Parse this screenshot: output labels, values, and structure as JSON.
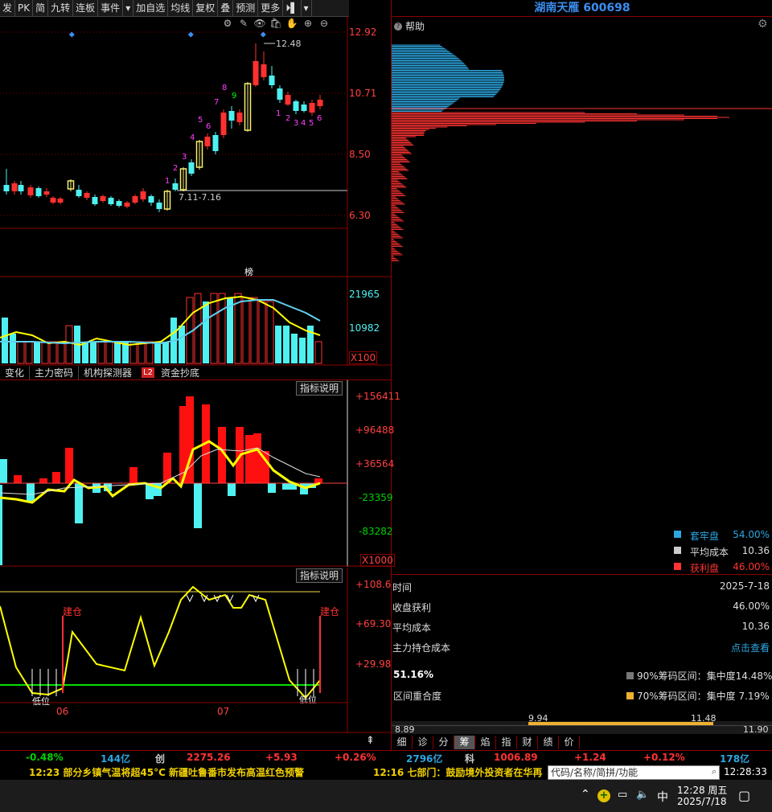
{
  "toolbar": {
    "items": [
      "发",
      "PK",
      "简",
      "九转",
      "连板",
      "事件",
      "▾",
      "加自选",
      "均线",
      "复权",
      "叠",
      "预测",
      "更多",
      "⏵▌",
      "▾"
    ]
  },
  "chart_tools": [
    "⚙",
    "✎",
    "👁",
    "🛍",
    "✋",
    "⊕",
    "⊖"
  ],
  "price_axis": [
    "12.92",
    "10.71",
    "8.50",
    "6.30"
  ],
  "annotations": {
    "high": "12.48",
    "range": "7.11-7.16",
    "bang": "榜",
    "td_up": [
      "1",
      "2",
      "3",
      "4",
      "5",
      "6",
      "7",
      "8",
      "9"
    ],
    "td_down": [
      "1",
      "2",
      "3",
      "4",
      "5",
      "6"
    ]
  },
  "volume": {
    "axis": [
      "21965",
      "10982",
      "X100"
    ]
  },
  "indicator_tabs": [
    "变化",
    "主力密码",
    "机构探测器",
    "L2",
    "资金抄底"
  ],
  "indicator1": {
    "button": "指标说明",
    "axis": [
      "+156411",
      "+96488",
      "+36564",
      "-23359",
      "-83282"
    ],
    "unit": "X1000"
  },
  "indicator2": {
    "button": "指标说明",
    "axis": [
      "+108.6",
      "+69.30",
      "+29.98"
    ],
    "jiancang": "建仓",
    "low_label": "低位",
    "month_labels": [
      "06",
      "07"
    ]
  },
  "right": {
    "title": "湖南天雁 600698",
    "help": "帮助",
    "legend": [
      {
        "label": "套牢盘",
        "value": "54.00%",
        "color": "#2ca6e0"
      },
      {
        "label": "平均成本",
        "value": "10.36",
        "color": "#cccccc"
      },
      {
        "label": "获利盘",
        "value": "46.00%",
        "color": "#ff3333"
      }
    ],
    "info": [
      {
        "label": "时间",
        "value": "2025-7-18"
      },
      {
        "label": "收盘获利",
        "value": "46.00%"
      },
      {
        "label": "平均成本",
        "value": "10.36"
      },
      {
        "label": "主力持仓成本",
        "value": "点击查看"
      }
    ],
    "overlap_pct": "51.16%",
    "overlap_label": "区间重合度",
    "band90": "90%筹码区间：集中度14.48%",
    "band70": "70%筹码区间：集中度 7.19%",
    "band_low": "8.89",
    "band_v1": "9.94",
    "band_v2": "11.48",
    "band_high": "11.90",
    "bottom_tabs": [
      "细",
      "诊",
      "分",
      "筹",
      "焰",
      "指",
      "财",
      "绩",
      "价"
    ]
  },
  "ticker1": [
    {
      "text": "-0.48%",
      "color": "#00d000"
    },
    {
      "text": "144亿",
      "color": "#2ca6e0"
    },
    {
      "text": "创",
      "color": "#ccc"
    },
    {
      "text": "2275.26",
      "color": "#ff3333"
    },
    {
      "text": "+5.93",
      "color": "#ff3333"
    },
    {
      "text": "+0.26%",
      "color": "#ff3333"
    },
    {
      "text": "2796亿",
      "color": "#2ca6e0"
    },
    {
      "text": "科",
      "color": "#ccc"
    },
    {
      "text": "1006.89",
      "color": "#ff3333"
    },
    {
      "text": "+1.24",
      "color": "#ff3333"
    },
    {
      "text": "+0.12%",
      "color": "#ff3333"
    },
    {
      "text": "178亿",
      "color": "#2ca6e0"
    }
  ],
  "ticker2": {
    "news1": "12:23 部分乡镇气温将超45°C 新疆吐鲁番市发布高温红色预警",
    "news2": "12:16 七部门：鼓励境外投资者在华再",
    "search_placeholder": "代码/名称/简拼/功能",
    "clock": "12:28:33"
  },
  "taskbar": {
    "ime": "中",
    "time": "12:28 周五",
    "date": "2025/7/18"
  }
}
